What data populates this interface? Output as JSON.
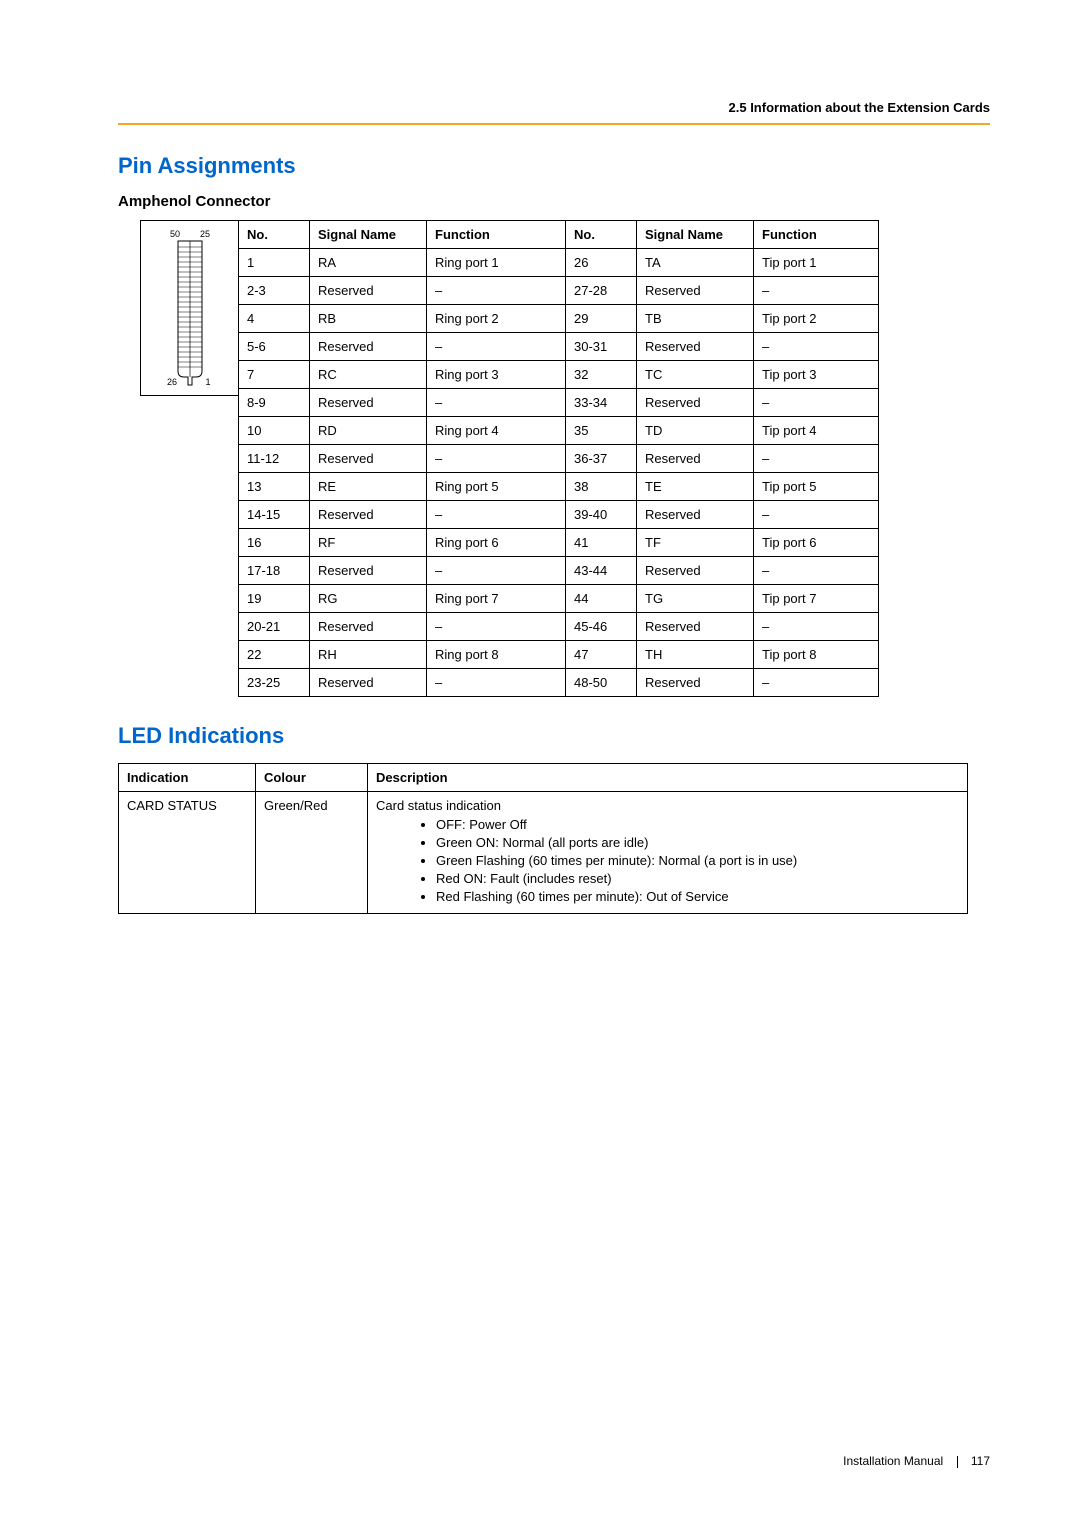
{
  "header": {
    "section": "2.5 Information about the Extension Cards"
  },
  "headings": {
    "pin": "Pin Assignments",
    "amphenol": "Amphenol Connector",
    "led": "LED Indications"
  },
  "connector_labels": {
    "tl": "50",
    "tr": "25",
    "bl": "26",
    "br": "1"
  },
  "pin_table": {
    "headers": {
      "no": "No.",
      "sig": "Signal Name",
      "fn": "Function"
    },
    "rows": [
      {
        "n1": "1",
        "s1": "RA",
        "f1": "Ring port 1",
        "n2": "26",
        "s2": "TA",
        "f2": "Tip port 1"
      },
      {
        "n1": "2-3",
        "s1": "Reserved",
        "f1": "–",
        "n2": "27-28",
        "s2": "Reserved",
        "f2": "–"
      },
      {
        "n1": "4",
        "s1": "RB",
        "f1": "Ring port 2",
        "n2": "29",
        "s2": "TB",
        "f2": "Tip port 2"
      },
      {
        "n1": "5-6",
        "s1": "Reserved",
        "f1": "–",
        "n2": "30-31",
        "s2": "Reserved",
        "f2": "–"
      },
      {
        "n1": "7",
        "s1": "RC",
        "f1": "Ring port 3",
        "n2": "32",
        "s2": "TC",
        "f2": "Tip port 3"
      },
      {
        "n1": "8-9",
        "s1": "Reserved",
        "f1": "–",
        "n2": "33-34",
        "s2": "Reserved",
        "f2": "–"
      },
      {
        "n1": "10",
        "s1": "RD",
        "f1": "Ring port 4",
        "n2": "35",
        "s2": "TD",
        "f2": "Tip port 4"
      },
      {
        "n1": "11-12",
        "s1": "Reserved",
        "f1": "–",
        "n2": "36-37",
        "s2": "Reserved",
        "f2": "–"
      },
      {
        "n1": "13",
        "s1": "RE",
        "f1": "Ring port 5",
        "n2": "38",
        "s2": "TE",
        "f2": "Tip port 5"
      },
      {
        "n1": "14-15",
        "s1": "Reserved",
        "f1": "–",
        "n2": "39-40",
        "s2": "Reserved",
        "f2": "–"
      },
      {
        "n1": "16",
        "s1": "RF",
        "f1": "Ring port 6",
        "n2": "41",
        "s2": "TF",
        "f2": "Tip port 6"
      },
      {
        "n1": "17-18",
        "s1": "Reserved",
        "f1": "–",
        "n2": "43-44",
        "s2": "Reserved",
        "f2": "–"
      },
      {
        "n1": "19",
        "s1": "RG",
        "f1": "Ring port 7",
        "n2": "44",
        "s2": "TG",
        "f2": "Tip port 7"
      },
      {
        "n1": "20-21",
        "s1": "Reserved",
        "f1": "–",
        "n2": "45-46",
        "s2": "Reserved",
        "f2": "–"
      },
      {
        "n1": "22",
        "s1": "RH",
        "f1": "Ring port 8",
        "n2": "47",
        "s2": "TH",
        "f2": "Tip port 8"
      },
      {
        "n1": "23-25",
        "s1": "Reserved",
        "f1": "–",
        "n2": "48-50",
        "s2": "Reserved",
        "f2": "–"
      }
    ]
  },
  "led_table": {
    "headers": {
      "ind": "Indication",
      "col": "Colour",
      "desc": "Description"
    },
    "row": {
      "ind": "CARD STATUS",
      "col": "Green/Red",
      "desc_head": "Card status indication",
      "items": [
        "OFF: Power Off",
        "Green ON: Normal (all ports are idle)",
        "Green Flashing (60 times per minute): Normal (a port is in use)",
        "Red ON: Fault (includes reset)",
        "Red Flashing (60 times per minute): Out of Service"
      ]
    }
  },
  "footer": {
    "book": "Installation Manual",
    "page": "117"
  }
}
